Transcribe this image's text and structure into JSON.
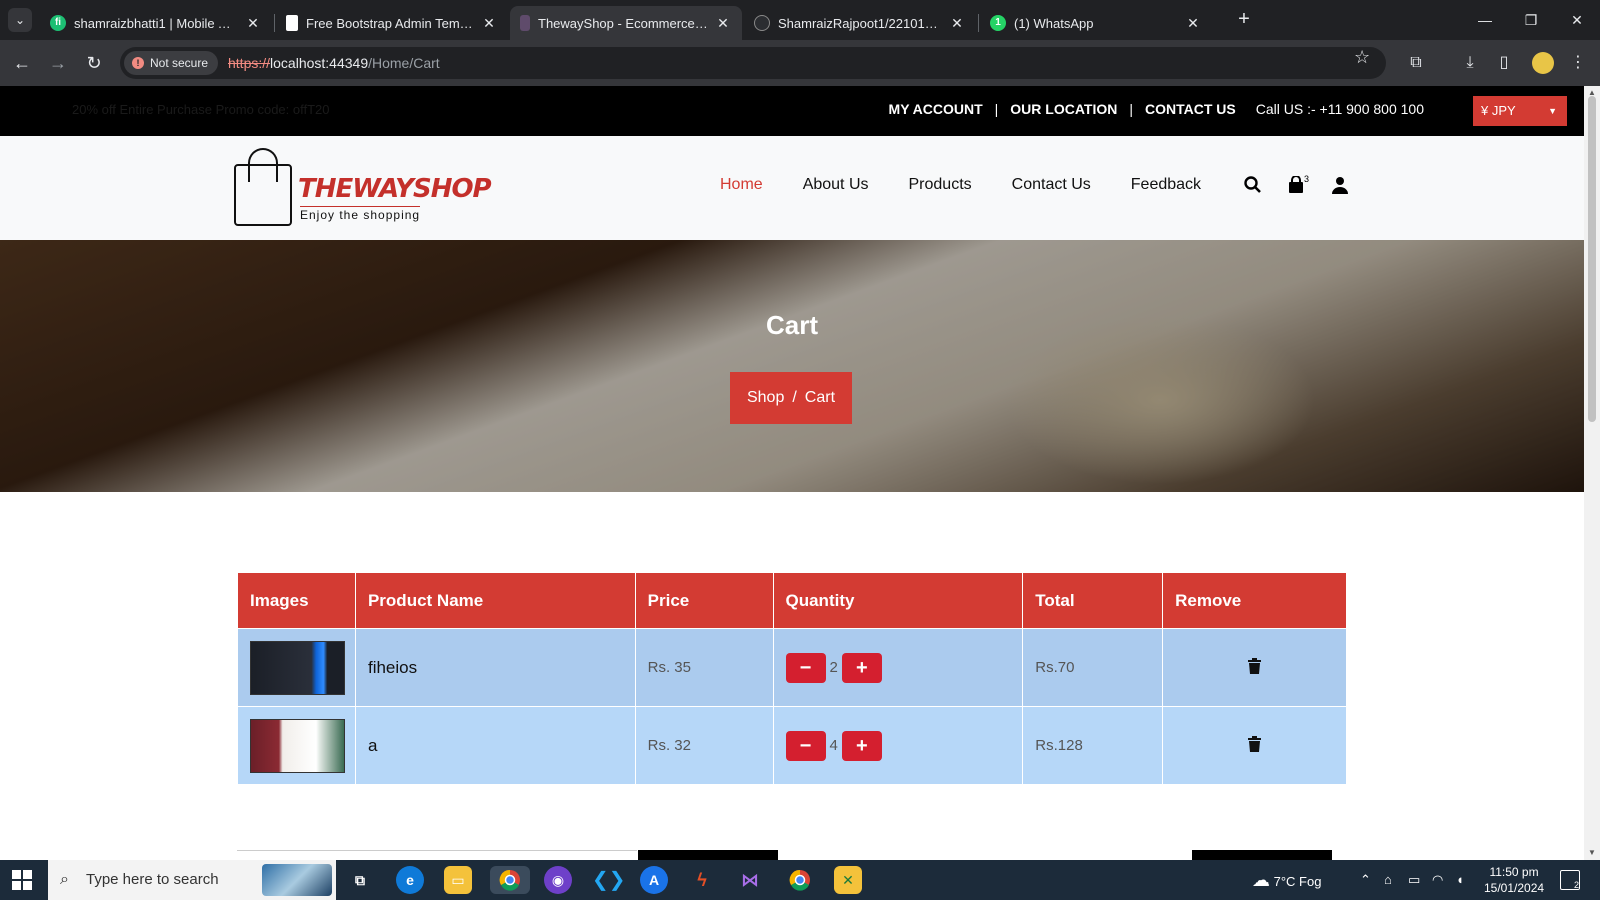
{
  "browser": {
    "tabs": [
      {
        "title": "shamraizbhatti1 | Mobile App M",
        "icon": "fiverr-icon",
        "color": "#1dbf73",
        "active": false
      },
      {
        "title": "Free Bootstrap Admin Template",
        "icon": "document-icon",
        "color": "#ffffff",
        "active": false
      },
      {
        "title": "ThewayShop - Ecommerce Boo",
        "icon": "shop-icon",
        "color": "#c4302b",
        "active": true
      },
      {
        "title": "ShamraizRajpoot1/22101002-0",
        "icon": "github-icon",
        "color": "#24292f",
        "active": false
      },
      {
        "title": "(1) WhatsApp",
        "icon": "whatsapp-icon",
        "color": "#25d366",
        "active": false
      }
    ],
    "whatsapp_badge": "1",
    "security_label": "Not secure",
    "url_scheme": "https://",
    "url_host": "localhost:44349",
    "url_path": "/Home/Cart"
  },
  "topbar": {
    "promo": "20% off Entire Purchase Promo code: offT20",
    "links": [
      "MY ACCOUNT",
      "OUR LOCATION",
      "CONTACT US"
    ],
    "call": "Call US :- +11 900 800 100",
    "currency": "¥ JPY"
  },
  "header": {
    "brand": "THEWAYSHOP",
    "tagline": "Enjoy the shopping",
    "nav": [
      "Home",
      "About Us",
      "Products",
      "Contact Us",
      "Feedback"
    ],
    "active_nav": "Home",
    "cart_count": "3"
  },
  "hero": {
    "title": "Cart",
    "breadcrumb": [
      "Shop",
      "Cart"
    ],
    "separator": "/"
  },
  "cart": {
    "headers": [
      "Images",
      "Product Name",
      "Price",
      "Quantity",
      "Total",
      "Remove"
    ],
    "rows": [
      {
        "name": "fiheios",
        "price": "Rs. 35",
        "qty": "2",
        "total": "Rs.70"
      },
      {
        "name": "a",
        "price": "Rs. 32",
        "qty": "4",
        "total": "Rs.128"
      }
    ]
  },
  "taskbar": {
    "search_placeholder": "Type here to search",
    "weather": "7°C  Fog",
    "time": "11:50 pm",
    "date": "15/01/2024",
    "notifications": "2"
  },
  "colors": {
    "accent": "#d33b33",
    "row1": "#abcbee",
    "row2": "#b6d7f8"
  }
}
